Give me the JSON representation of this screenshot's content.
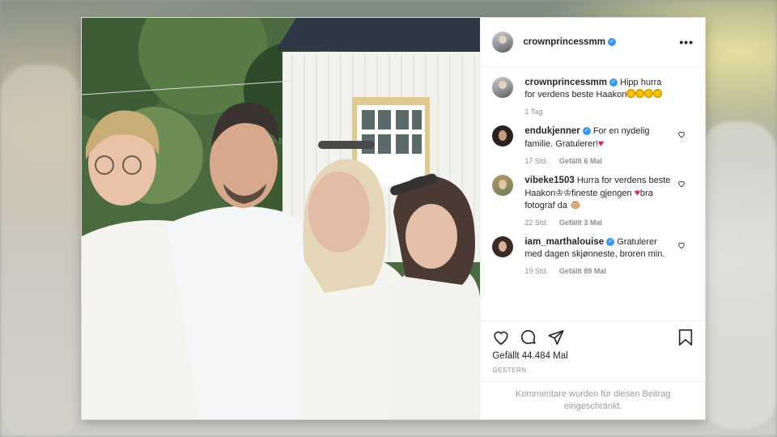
{
  "post": {
    "author": "crownprincessmm",
    "caption": {
      "author": "crownprincessmm",
      "text": "Hipp hurra for verdens beste Haakon",
      "time": "1 Tag"
    },
    "comments": [
      {
        "author": "endukjenner",
        "verified": true,
        "text": "For en nydelig familie. Gratulerer!",
        "time": "17 Std.",
        "likes": "Gefällt 6 Mal"
      },
      {
        "author": "vibeke1503",
        "verified": false,
        "text_a": "Hurra for verdens beste Haakon",
        "text_b": "fineste gjengen",
        "text_c": "bra fotograf da",
        "time": "22 Std.",
        "likes": "Gefällt 3 Mal"
      },
      {
        "author": "iam_marthalouise",
        "verified": true,
        "text": "Gratulerer med dagen skjønneste, broren min.",
        "time": "19 Std.",
        "likes": "Gefällt 89 Mal"
      }
    ],
    "like_count": "Gefällt 44.484 Mal",
    "date_label": "GESTERN",
    "comments_disabled": "Kommentare wurden für diesen Beitrag eingeschränkt."
  },
  "colors": {
    "verified": "#3897f0",
    "text": "#262626",
    "muted": "#8e8e8e"
  },
  "icons": [
    "more-icon",
    "verified-icon",
    "heart-icon",
    "comment-icon",
    "share-icon",
    "bookmark-icon"
  ]
}
